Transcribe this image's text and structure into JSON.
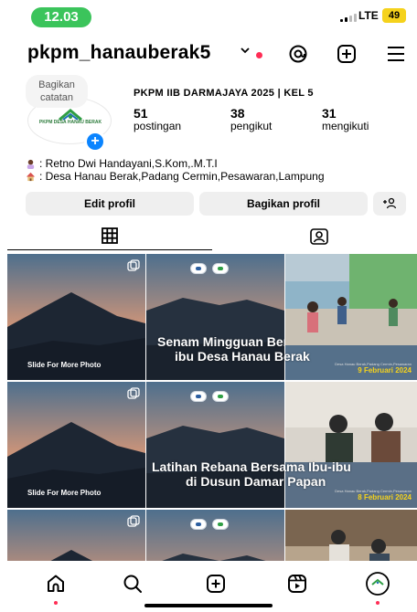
{
  "status_bar": {
    "time": "12.03",
    "network": "LTE",
    "battery": "49",
    "battery_color": "#f5d21c",
    "time_pill_color": "#3bc45b"
  },
  "header": {
    "username": "pkpm_hanauberak5",
    "icons": [
      "chevron-down-icon",
      "threads-icon",
      "add-post-icon",
      "menu-icon"
    ]
  },
  "profile": {
    "note": "Bagikan catatan",
    "avatar_text": "PKPM DESA HANAU BERAK",
    "name": "PKPM IIB DARMAJAYA 2025 | KEL 5",
    "stats": [
      {
        "value": "51",
        "label": "postingan"
      },
      {
        "value": "38",
        "label": "pengikut"
      },
      {
        "value": "31",
        "label": "mengikuti"
      }
    ],
    "bio": [
      {
        "icon": "person-icon",
        "text": ": Retno Dwi Handayani,S.Kom,.M.T.I"
      },
      {
        "icon": "house-icon",
        "text": ": Desa Hanau Berak,Padang Cermin,Pesawaran,Lampung"
      }
    ]
  },
  "buttons": {
    "edit_profile": "Edit profil",
    "share_profile": "Bagikan profil",
    "add_person": "add-person-icon"
  },
  "tabs": [
    "grid-icon",
    "tagged-icon"
  ],
  "posts": [
    {
      "type": "slide",
      "text": "Slide For More Photo"
    },
    {
      "type": "title",
      "caption": "Senam Mingguan Bersama Ibu-"
    },
    {
      "type": "photo",
      "caption": "ibu Desa Hanau Berak",
      "date": "9 Februari 2024",
      "location": "Desa Hanau Berak,Padang Cermin,Pesawaran"
    },
    {
      "type": "slide",
      "text": "Slide For More Photo"
    },
    {
      "type": "title",
      "caption": "Latihan Rebana Bersama Ibu-ibu",
      "caption2": "di Dusun Damar Papan"
    },
    {
      "type": "photo",
      "date": "8 Februari 2024",
      "location": "Desa Hanau Berak,Padang Cermin,Pesawaran"
    },
    {
      "type": "slide"
    },
    {
      "type": "title"
    },
    {
      "type": "photo"
    }
  ],
  "nav": {
    "items": [
      "home-icon",
      "search-icon",
      "create-icon",
      "reels-icon",
      "profile-avatar"
    ],
    "accent": "#ff2d55"
  }
}
